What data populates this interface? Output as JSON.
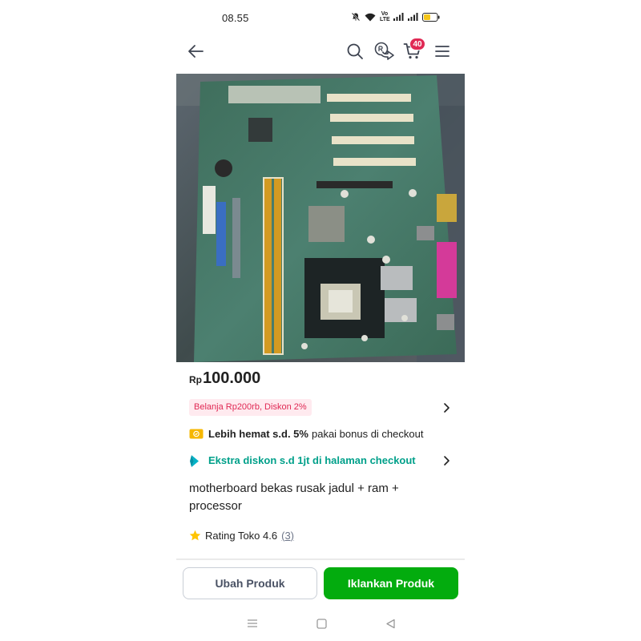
{
  "status_bar": {
    "time": "08.55",
    "network_label": "Vo LTE",
    "battery_color": "#f5c518"
  },
  "nav": {
    "icons": [
      "back-arrow-icon",
      "search-icon",
      "share-rp-icon",
      "cart-icon",
      "menu-icon"
    ],
    "cart_count": "40",
    "badge_color": "#e02954"
  },
  "product": {
    "image_icon": "motherboard-photo",
    "price_currency": "Rp",
    "price_value": "100.000",
    "promo_tag": "Belanja Rp200rb, Diskon 2%",
    "bonus_bold": "Lebih hemat s.d. 5%",
    "bonus_rest": "pakai bonus di checkout",
    "extra_discount": "Ekstra diskon s.d 1jt di halaman checkout",
    "title": "motherboard bekas rusak jadul + ram + processor",
    "rating_label": "Rating Toko 4.6",
    "rating_count": "(3)"
  },
  "actions": {
    "edit_label": "Ubah Produk",
    "advertise_label": "Iklankan Produk",
    "primary_color": "#03ac0e"
  },
  "system_nav": {
    "icons": [
      "recents-icon",
      "home-icon",
      "back-icon"
    ]
  }
}
